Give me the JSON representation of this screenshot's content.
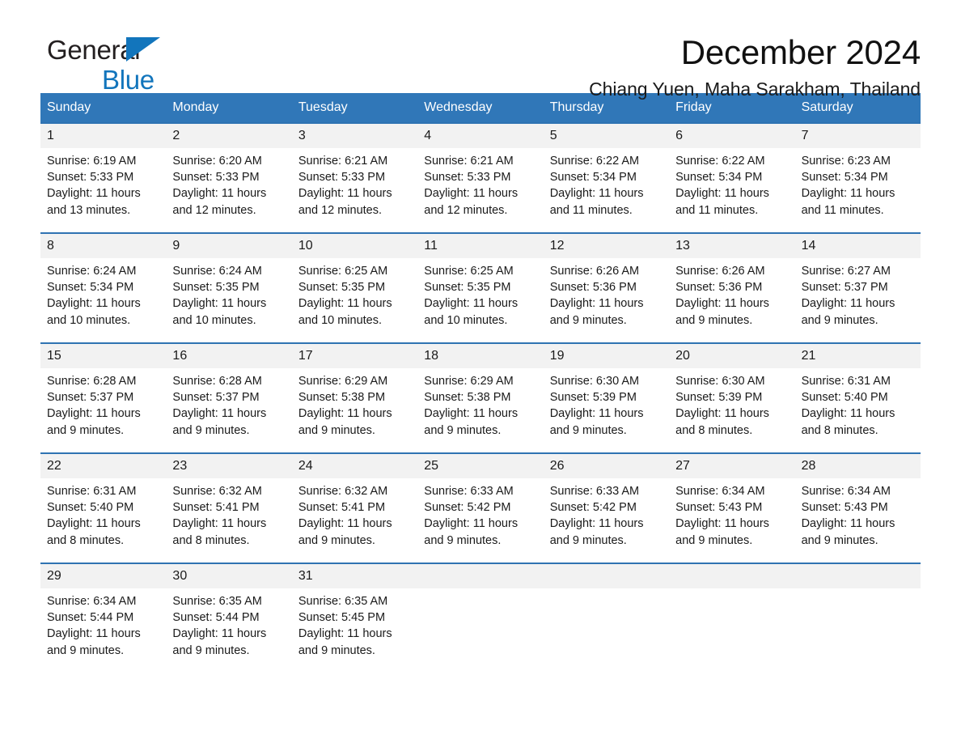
{
  "brand": {
    "name_part1": "General",
    "name_part2": "Blue",
    "triangle_color": "#1275bc"
  },
  "header": {
    "title": "December 2024",
    "subtitle": "Chiang Yuen, Maha Sarakham, Thailand",
    "header_bg": "#3077b8",
    "daynum_bg": "#f2f2f2"
  },
  "weekdays": [
    "Sunday",
    "Monday",
    "Tuesday",
    "Wednesday",
    "Thursday",
    "Friday",
    "Saturday"
  ],
  "weeks": [
    {
      "days": [
        {
          "num": "1",
          "sunrise": "Sunrise: 6:19 AM",
          "sunset": "Sunset: 5:33 PM",
          "daylight1": "Daylight: 11 hours",
          "daylight2": "and 13 minutes."
        },
        {
          "num": "2",
          "sunrise": "Sunrise: 6:20 AM",
          "sunset": "Sunset: 5:33 PM",
          "daylight1": "Daylight: 11 hours",
          "daylight2": "and 12 minutes."
        },
        {
          "num": "3",
          "sunrise": "Sunrise: 6:21 AM",
          "sunset": "Sunset: 5:33 PM",
          "daylight1": "Daylight: 11 hours",
          "daylight2": "and 12 minutes."
        },
        {
          "num": "4",
          "sunrise": "Sunrise: 6:21 AM",
          "sunset": "Sunset: 5:33 PM",
          "daylight1": "Daylight: 11 hours",
          "daylight2": "and 12 minutes."
        },
        {
          "num": "5",
          "sunrise": "Sunrise: 6:22 AM",
          "sunset": "Sunset: 5:34 PM",
          "daylight1": "Daylight: 11 hours",
          "daylight2": "and 11 minutes."
        },
        {
          "num": "6",
          "sunrise": "Sunrise: 6:22 AM",
          "sunset": "Sunset: 5:34 PM",
          "daylight1": "Daylight: 11 hours",
          "daylight2": "and 11 minutes."
        },
        {
          "num": "7",
          "sunrise": "Sunrise: 6:23 AM",
          "sunset": "Sunset: 5:34 PM",
          "daylight1": "Daylight: 11 hours",
          "daylight2": "and 11 minutes."
        }
      ]
    },
    {
      "days": [
        {
          "num": "8",
          "sunrise": "Sunrise: 6:24 AM",
          "sunset": "Sunset: 5:34 PM",
          "daylight1": "Daylight: 11 hours",
          "daylight2": "and 10 minutes."
        },
        {
          "num": "9",
          "sunrise": "Sunrise: 6:24 AM",
          "sunset": "Sunset: 5:35 PM",
          "daylight1": "Daylight: 11 hours",
          "daylight2": "and 10 minutes."
        },
        {
          "num": "10",
          "sunrise": "Sunrise: 6:25 AM",
          "sunset": "Sunset: 5:35 PM",
          "daylight1": "Daylight: 11 hours",
          "daylight2": "and 10 minutes."
        },
        {
          "num": "11",
          "sunrise": "Sunrise: 6:25 AM",
          "sunset": "Sunset: 5:35 PM",
          "daylight1": "Daylight: 11 hours",
          "daylight2": "and 10 minutes."
        },
        {
          "num": "12",
          "sunrise": "Sunrise: 6:26 AM",
          "sunset": "Sunset: 5:36 PM",
          "daylight1": "Daylight: 11 hours",
          "daylight2": "and 9 minutes."
        },
        {
          "num": "13",
          "sunrise": "Sunrise: 6:26 AM",
          "sunset": "Sunset: 5:36 PM",
          "daylight1": "Daylight: 11 hours",
          "daylight2": "and 9 minutes."
        },
        {
          "num": "14",
          "sunrise": "Sunrise: 6:27 AM",
          "sunset": "Sunset: 5:37 PM",
          "daylight1": "Daylight: 11 hours",
          "daylight2": "and 9 minutes."
        }
      ]
    },
    {
      "days": [
        {
          "num": "15",
          "sunrise": "Sunrise: 6:28 AM",
          "sunset": "Sunset: 5:37 PM",
          "daylight1": "Daylight: 11 hours",
          "daylight2": "and 9 minutes."
        },
        {
          "num": "16",
          "sunrise": "Sunrise: 6:28 AM",
          "sunset": "Sunset: 5:37 PM",
          "daylight1": "Daylight: 11 hours",
          "daylight2": "and 9 minutes."
        },
        {
          "num": "17",
          "sunrise": "Sunrise: 6:29 AM",
          "sunset": "Sunset: 5:38 PM",
          "daylight1": "Daylight: 11 hours",
          "daylight2": "and 9 minutes."
        },
        {
          "num": "18",
          "sunrise": "Sunrise: 6:29 AM",
          "sunset": "Sunset: 5:38 PM",
          "daylight1": "Daylight: 11 hours",
          "daylight2": "and 9 minutes."
        },
        {
          "num": "19",
          "sunrise": "Sunrise: 6:30 AM",
          "sunset": "Sunset: 5:39 PM",
          "daylight1": "Daylight: 11 hours",
          "daylight2": "and 9 minutes."
        },
        {
          "num": "20",
          "sunrise": "Sunrise: 6:30 AM",
          "sunset": "Sunset: 5:39 PM",
          "daylight1": "Daylight: 11 hours",
          "daylight2": "and 8 minutes."
        },
        {
          "num": "21",
          "sunrise": "Sunrise: 6:31 AM",
          "sunset": "Sunset: 5:40 PM",
          "daylight1": "Daylight: 11 hours",
          "daylight2": "and 8 minutes."
        }
      ]
    },
    {
      "days": [
        {
          "num": "22",
          "sunrise": "Sunrise: 6:31 AM",
          "sunset": "Sunset: 5:40 PM",
          "daylight1": "Daylight: 11 hours",
          "daylight2": "and 8 minutes."
        },
        {
          "num": "23",
          "sunrise": "Sunrise: 6:32 AM",
          "sunset": "Sunset: 5:41 PM",
          "daylight1": "Daylight: 11 hours",
          "daylight2": "and 8 minutes."
        },
        {
          "num": "24",
          "sunrise": "Sunrise: 6:32 AM",
          "sunset": "Sunset: 5:41 PM",
          "daylight1": "Daylight: 11 hours",
          "daylight2": "and 9 minutes."
        },
        {
          "num": "25",
          "sunrise": "Sunrise: 6:33 AM",
          "sunset": "Sunset: 5:42 PM",
          "daylight1": "Daylight: 11 hours",
          "daylight2": "and 9 minutes."
        },
        {
          "num": "26",
          "sunrise": "Sunrise: 6:33 AM",
          "sunset": "Sunset: 5:42 PM",
          "daylight1": "Daylight: 11 hours",
          "daylight2": "and 9 minutes."
        },
        {
          "num": "27",
          "sunrise": "Sunrise: 6:34 AM",
          "sunset": "Sunset: 5:43 PM",
          "daylight1": "Daylight: 11 hours",
          "daylight2": "and 9 minutes."
        },
        {
          "num": "28",
          "sunrise": "Sunrise: 6:34 AM",
          "sunset": "Sunset: 5:43 PM",
          "daylight1": "Daylight: 11 hours",
          "daylight2": "and 9 minutes."
        }
      ]
    },
    {
      "days": [
        {
          "num": "29",
          "sunrise": "Sunrise: 6:34 AM",
          "sunset": "Sunset: 5:44 PM",
          "daylight1": "Daylight: 11 hours",
          "daylight2": "and 9 minutes."
        },
        {
          "num": "30",
          "sunrise": "Sunrise: 6:35 AM",
          "sunset": "Sunset: 5:44 PM",
          "daylight1": "Daylight: 11 hours",
          "daylight2": "and 9 minutes."
        },
        {
          "num": "31",
          "sunrise": "Sunrise: 6:35 AM",
          "sunset": "Sunset: 5:45 PM",
          "daylight1": "Daylight: 11 hours",
          "daylight2": "and 9 minutes."
        },
        {
          "num": "",
          "sunrise": "",
          "sunset": "",
          "daylight1": "",
          "daylight2": ""
        },
        {
          "num": "",
          "sunrise": "",
          "sunset": "",
          "daylight1": "",
          "daylight2": ""
        },
        {
          "num": "",
          "sunrise": "",
          "sunset": "",
          "daylight1": "",
          "daylight2": ""
        },
        {
          "num": "",
          "sunrise": "",
          "sunset": "",
          "daylight1": "",
          "daylight2": ""
        }
      ]
    }
  ]
}
